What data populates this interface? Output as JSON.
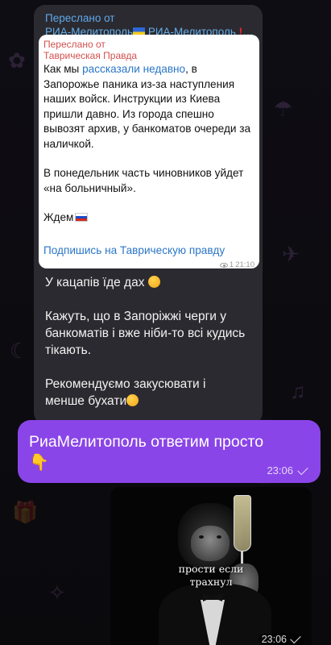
{
  "forwarded_header": {
    "line1": "Переслано от",
    "line2_prefix": "РИА-Мелитополь",
    "line2_suffix": " РИА-Мелитополь",
    "line2_tail": " В..."
  },
  "inner_post": {
    "forwarded_label": "Переслано от",
    "forwarded_source": "Таврическая Правда",
    "p1_before_link": "Как мы ",
    "p1_link": "рассказали недавно",
    "p1_after_link": ", в Запорожье паника из-за наступления наших войск. Инструкции из Киева пришли давно. Из города спешно вывозят архив, у банкоматов очереди за наличкой.",
    "p2": "В понедельник часть чиновников уйдет «на больничный».",
    "p3": "Ждем",
    "subscribe_link": "Подпишись на Таврическую правду",
    "views": "1",
    "time": "21:10"
  },
  "comment": {
    "p1": "У кацапів їде дах",
    "p2": "Кажуть, що в Запоріжжі черги у банкоматів і вже ніби-то всі кудись тікають.",
    "p3": "Рекомендуємо закусювати і менше бухати"
  },
  "reply": {
    "text": "РиаМелитополь ответим просто",
    "emoji": "👇",
    "time": "23:06"
  },
  "image_message": {
    "caption_line1": "прости если",
    "caption_line2": "трахнул",
    "time": "23:06"
  },
  "colors": {
    "accent_purple": "#8a45e8",
    "link_blue": "#2a76c6",
    "forward_red": "#d2504e",
    "header_blue": "#5fa8ea"
  }
}
